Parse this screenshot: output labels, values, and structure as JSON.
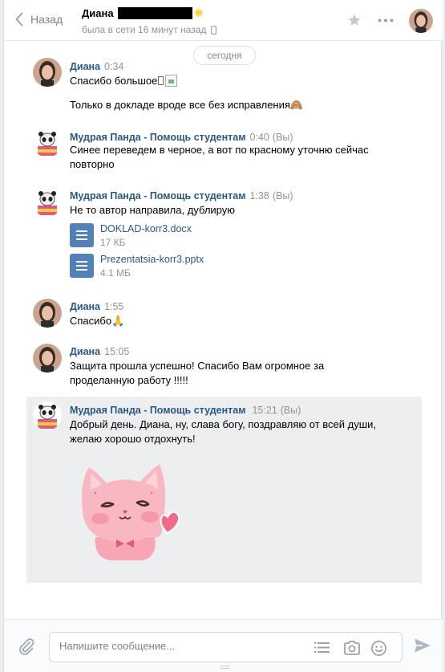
{
  "header": {
    "back_label": "Назад",
    "peer_name": "Диана",
    "peer_status": "была в сети 16 минут назад",
    "name_emoji": "🌟"
  },
  "date_divider": "сегодня",
  "messages": [
    {
      "author": "Диана",
      "time": "0:34",
      "lines": [
        "Спасибо большое",
        "Только в докладе вроде все без исправления🙈"
      ]
    },
    {
      "author": "Мудрая Панда - Помощь студентам",
      "time": "0:40",
      "you": "(Вы)",
      "lines": [
        "Синее переведем в черное, а вот по красному уточню сейчас",
        "повторно"
      ]
    },
    {
      "author": "Мудрая Панда - Помощь студентам",
      "time": "1:38",
      "you": "(Вы)",
      "lines": [
        "Не то автор направила, дублирую"
      ],
      "docs": [
        {
          "name": "DOKLAD-korr3.docx",
          "size": "17 КБ"
        },
        {
          "name": "Prezentatsia-korr3.pptx",
          "size": "4.1 МБ"
        }
      ]
    },
    {
      "author": "Диана",
      "time": "1:55",
      "lines": [
        "Спасибо🙏"
      ]
    },
    {
      "author": "Диана",
      "time": "15:05",
      "lines": [
        "Защита прошла успешно! Спасибо Вам огромное за",
        "проделанную работу !!!!!"
      ]
    },
    {
      "author": "Мудрая Панда - Помощь студентам",
      "time": "15:21",
      "you": "(Вы)",
      "lines": [
        "Добрый день. Диана, ну, слава богу, поздравляю от всей души,",
        "желаю хорошо отдохнуть!"
      ],
      "sticker": "pink-cat-heart-sticker"
    }
  ],
  "composer": {
    "placeholder": "Напишите сообщение..."
  },
  "colors": {
    "link": "#2a5885",
    "accent": "#5181b8",
    "muted": "#939393",
    "highlight_bg": "#edeef0"
  },
  "icons": [
    "chevron-left-icon",
    "phone-icon",
    "star-icon",
    "more-icon",
    "paperclip-icon",
    "list-icon",
    "camera-icon",
    "smile-icon",
    "send-icon",
    "document-icon"
  ]
}
